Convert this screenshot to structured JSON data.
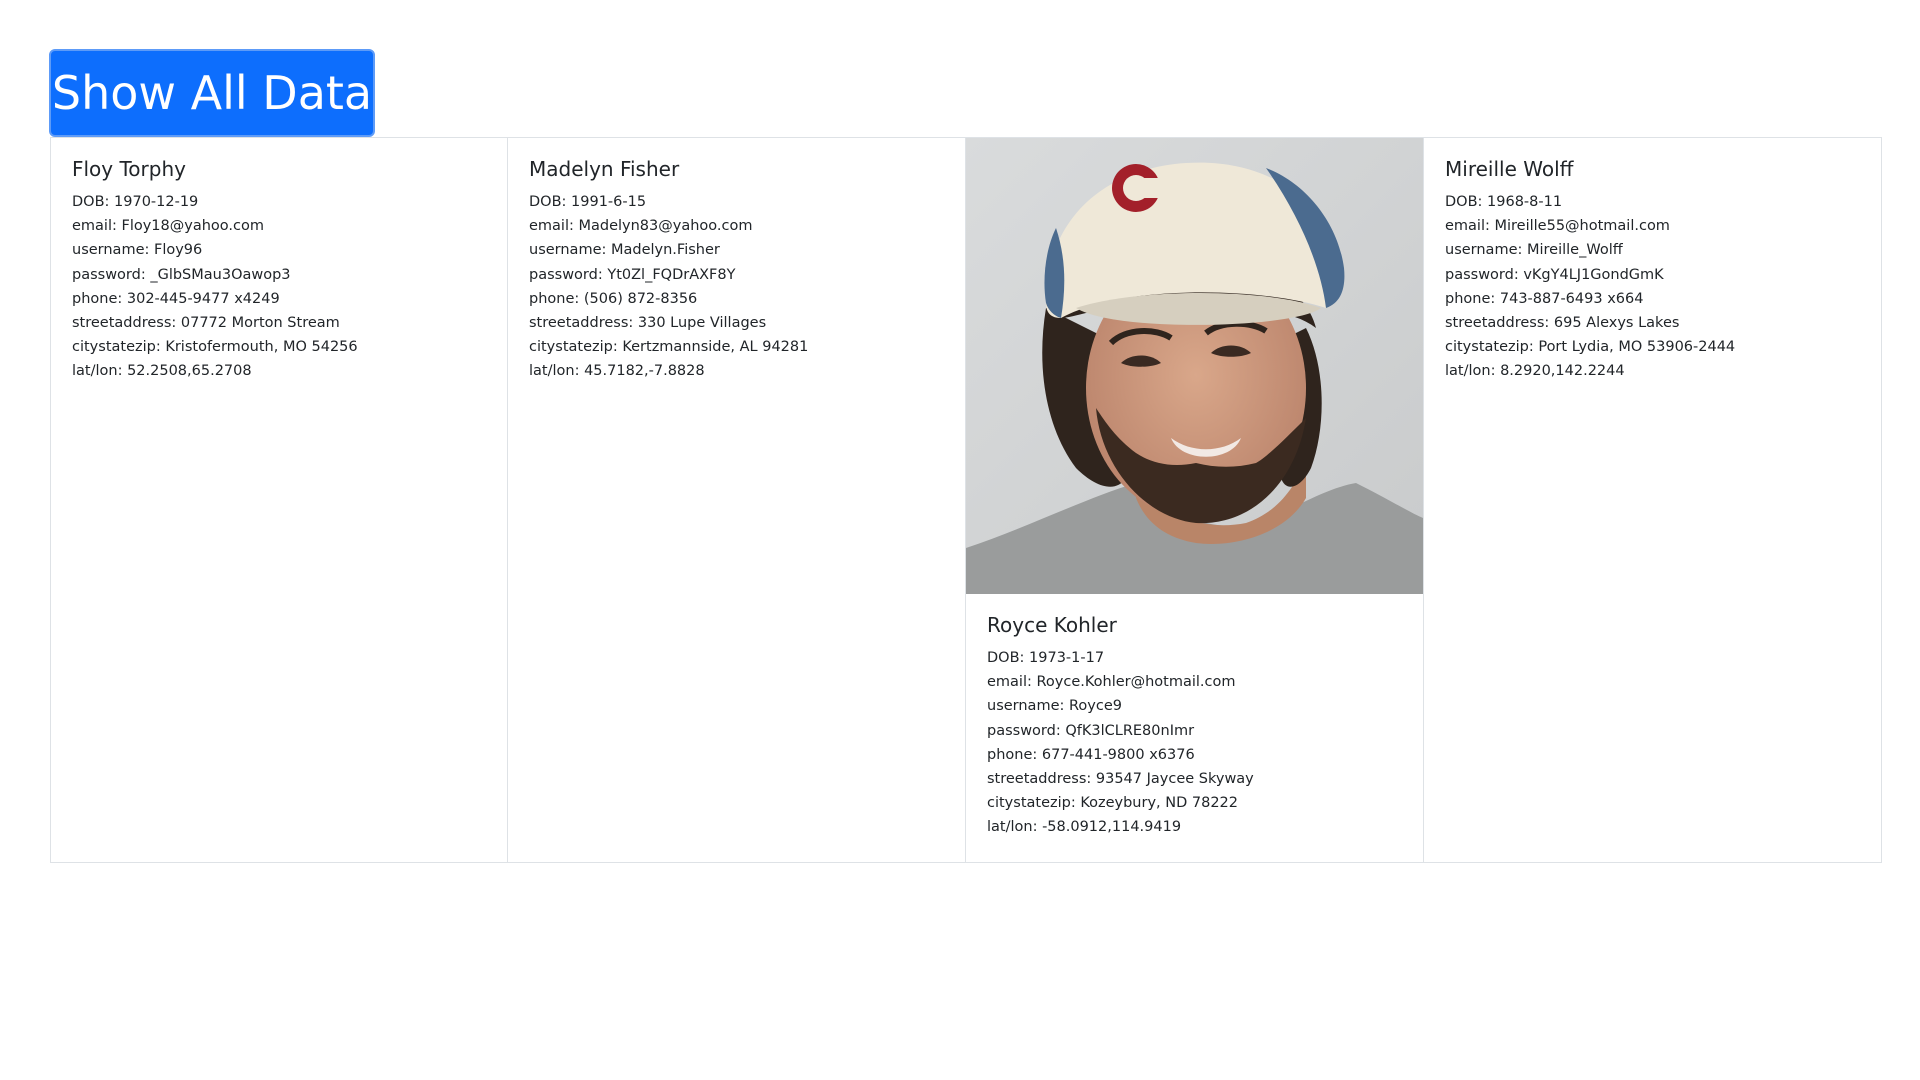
{
  "button": {
    "label": "Show All Data"
  },
  "cards": [
    {
      "name": "Floy Torphy",
      "dob": "DOB: 1970-12-19",
      "email": "email: Floy18@yahoo.com",
      "username": "username: Floy96",
      "password": "password: _GlbSMau3Oawop3",
      "phone": "phone: 302-445-9477 x4249",
      "streetaddress": "streetaddress: 07772 Morton Stream",
      "citystatezip": "citystatezip: Kristofermouth, MO 54256",
      "latlon": "lat/lon: 52.2508,65.2708"
    },
    {
      "name": "Madelyn Fisher",
      "dob": "DOB: 1991-6-15",
      "email": "email: Madelyn83@yahoo.com",
      "username": "username: Madelyn.Fisher",
      "password": "password: Yt0Zl_FQDrAXF8Y",
      "phone": "phone: (506) 872-8356",
      "streetaddress": "streetaddress: 330 Lupe Villages",
      "citystatezip": "citystatezip: Kertzmannside, AL 94281",
      "latlon": "lat/lon: 45.7182,-7.8828"
    },
    {
      "name": "Royce Kohler",
      "dob": "DOB: 1973-1-17",
      "email": "email: Royce.Kohler@hotmail.com",
      "username": "username: Royce9",
      "password": "password: QfK3lCLRE80nImr",
      "phone": "phone: 677-441-9800 x6376",
      "streetaddress": "streetaddress: 93547 Jaycee Skyway",
      "citystatezip": "citystatezip: Kozeybury, ND 78222",
      "latlon": "lat/lon: -58.0912,114.9419"
    },
    {
      "name": "Mireille Wolff",
      "dob": "DOB: 1968-8-11",
      "email": "email: Mireille55@hotmail.com",
      "username": "username: Mireille_Wolff",
      "password": "password: vKgY4LJ1GondGmK",
      "phone": "phone: 743-887-6493 x664",
      "streetaddress": "streetaddress: 695 Alexys Lakes",
      "citystatezip": "citystatezip: Port Lydia, MO 53906-2444",
      "latlon": "lat/lon: 8.2920,142.2244"
    }
  ]
}
